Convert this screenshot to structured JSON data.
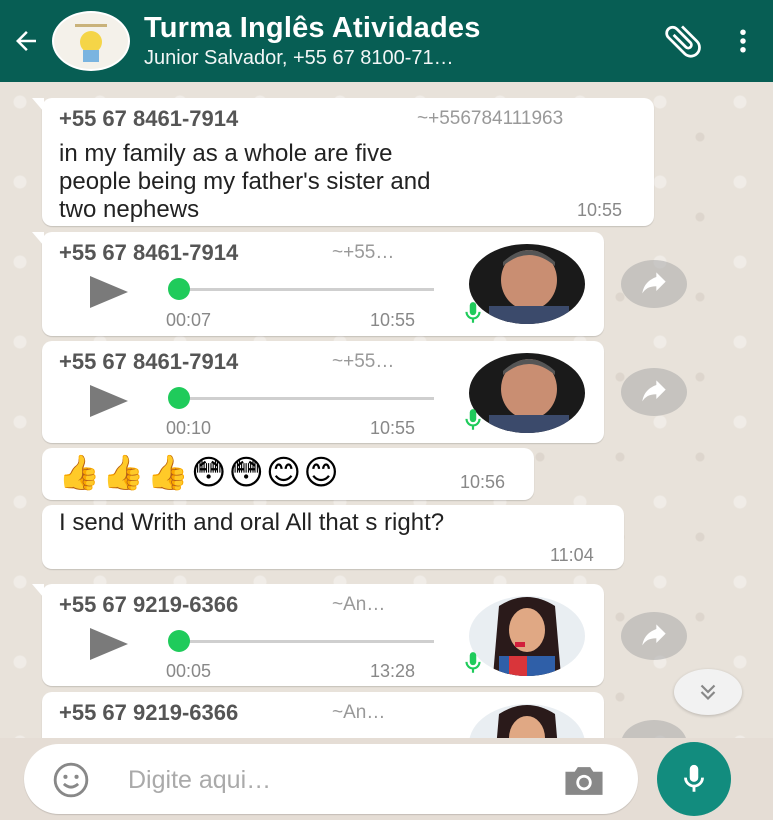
{
  "header": {
    "title": "Turma Inglês Atividades",
    "subtitle": "Junior Salvador, +55 67 8100-71…"
  },
  "messages": [
    {
      "sender": "+55 67 8461-7914",
      "alias": "~+556784111963",
      "text": "in my family as a whole are five\npeople being my father's sister and\ntwo nephews",
      "time": "10:55"
    },
    {
      "sender": "+55 67 8461-7914",
      "alias": "~+55…",
      "duration": "00:07",
      "time": "10:55",
      "progress": 0
    },
    {
      "sender": "+55 67 8461-7914",
      "alias": "~+55…",
      "duration": "00:10",
      "time": "10:55",
      "progress": 0
    },
    {
      "emoji": "👍👍👍😳😳😊😊",
      "time": "10:56"
    },
    {
      "text": "I send Writh and oral All that s right?",
      "time": "11:04"
    },
    {
      "sender": "+55 67 9219-6366",
      "alias": "~An…",
      "duration": "00:05",
      "time": "13:28",
      "progress": 0
    },
    {
      "sender": "+55 67 9219-6366",
      "alias": "~An…"
    }
  ],
  "composer": {
    "placeholder": "Digite aqui…"
  },
  "colors": {
    "header": "#075e54",
    "accent": "#128c7e",
    "voice_dot": "#1fcb5b",
    "background": "#e5ddd5"
  },
  "icons": [
    "back-arrow-icon",
    "paperclip-icon",
    "more-vert-icon",
    "play-icon",
    "mic-icon",
    "forward-icon",
    "double-chevron-down-icon",
    "emoji-icon",
    "camera-icon"
  ]
}
